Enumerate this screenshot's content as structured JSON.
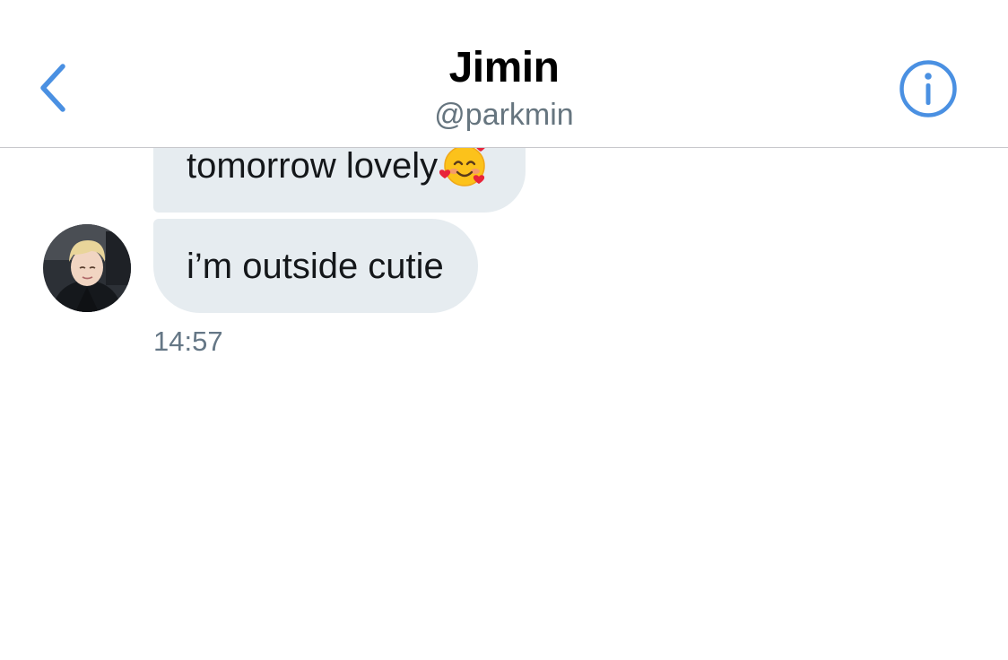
{
  "header": {
    "title": "Jimin",
    "handle": "@parkmin",
    "back_icon": "chevron-left-icon",
    "info_icon": "info-circle-icon"
  },
  "conversation": {
    "messages": [
      {
        "text": "tomorrow lovely",
        "emoji": "smiling-face-with-hearts"
      },
      {
        "text": "i’m outside cutie"
      }
    ],
    "timestamp": "14:57"
  },
  "colors": {
    "accent": "#4a90e2",
    "bubble_bg": "#e6ecf0",
    "message_text": "#14171a",
    "secondary_text": "#657786",
    "divider": "#c8c8cc"
  }
}
